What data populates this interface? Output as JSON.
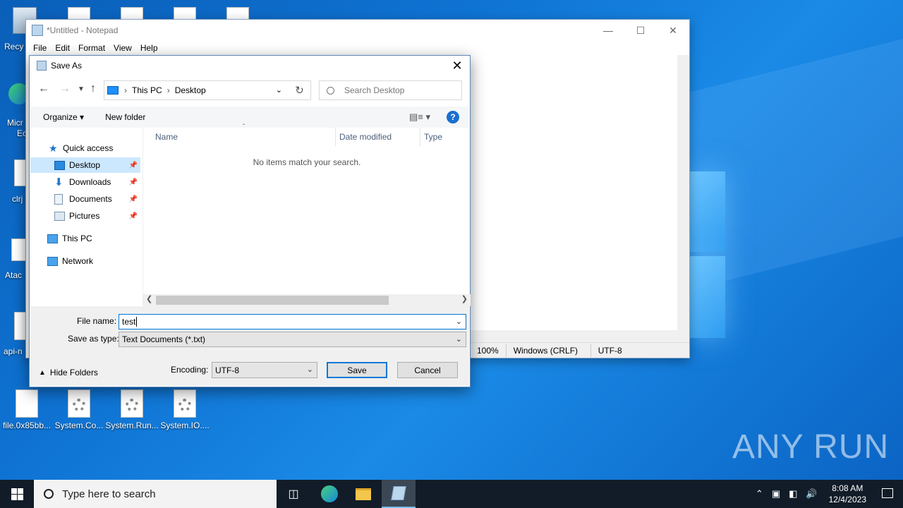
{
  "desktop": {
    "icons": [
      {
        "label": "file.0x85bb..."
      },
      {
        "label": "System.Co..."
      },
      {
        "label": "System.Run..."
      },
      {
        "label": "System.IO...."
      }
    ],
    "partial_labels": [
      "Recy",
      "Micr",
      "Ec",
      "clrj",
      "Atac",
      "api-n"
    ],
    "watermark": "ANY RUN"
  },
  "notepad": {
    "title": "*Untitled - Notepad",
    "menu": [
      "File",
      "Edit",
      "Format",
      "View",
      "Help"
    ],
    "status": {
      "zoom": "100%",
      "line_ending": "Windows (CRLF)",
      "encoding": "UTF-8"
    }
  },
  "save_as": {
    "title": "Save As",
    "address": {
      "root": "This PC",
      "folder": "Desktop"
    },
    "search_placeholder": "Search Desktop",
    "toolbar": {
      "organize": "Organize",
      "new_folder": "New folder",
      "help": "?"
    },
    "nav": {
      "quick_access": "Quick access",
      "items": [
        {
          "label": "Desktop",
          "pinned": true,
          "selected": true
        },
        {
          "label": "Downloads",
          "pinned": true
        },
        {
          "label": "Documents",
          "pinned": true
        },
        {
          "label": "Pictures",
          "pinned": true
        }
      ],
      "this_pc": "This PC",
      "network": "Network"
    },
    "columns": {
      "name": "Name",
      "date_modified": "Date modified",
      "type": "Type"
    },
    "empty_message": "No items match your search.",
    "file_name_label": "File name:",
    "file_name_value": "test",
    "save_as_type_label": "Save as type:",
    "save_as_type_value": "Text Documents (*.txt)",
    "hide_folders": "Hide Folders",
    "encoding_label": "Encoding:",
    "encoding_value": "UTF-8",
    "save_button": "Save",
    "cancel_button": "Cancel"
  },
  "taskbar": {
    "search_placeholder": "Type here to search",
    "time": "8:08 AM",
    "date": "12/4/2023"
  }
}
